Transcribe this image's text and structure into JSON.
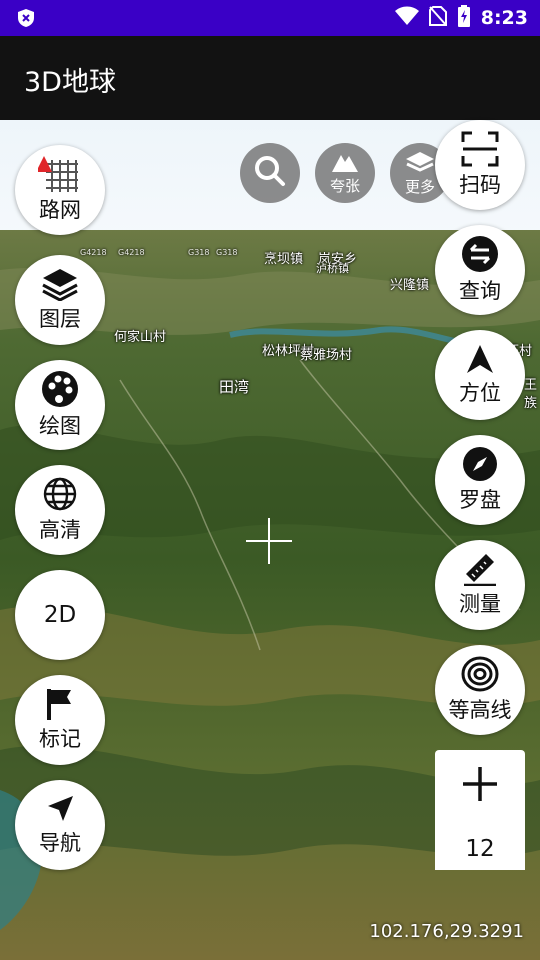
{
  "status_bar": {
    "time": "8:23",
    "icons": [
      "shield-icon",
      "wifi-icon",
      "no-sim-icon",
      "battery-charging-icon"
    ]
  },
  "app_bar": {
    "title": "3D地球"
  },
  "map": {
    "labels": [
      {
        "text": "烹坝镇"
      },
      {
        "text": "岚安乡"
      },
      {
        "text": "泸桥镇"
      },
      {
        "text": "兴隆镇"
      },
      {
        "text": "何家山村"
      },
      {
        "text": "松林坪村"
      },
      {
        "text": "蔡雅场村"
      },
      {
        "text": "旺村"
      },
      {
        "text": "田湾"
      },
      {
        "text": "王"
      },
      {
        "text": "族"
      },
      {
        "text": "G4218"
      },
      {
        "text": "G4218"
      },
      {
        "text": "G318"
      },
      {
        "text": "G318"
      }
    ],
    "coordinates": "102.176,29.3291"
  },
  "top_buttons": {
    "search": {
      "icon": "search-icon"
    },
    "exaggerate": {
      "label": "夸张",
      "icon": "mountain-icon"
    },
    "more": {
      "label": "更多",
      "icon": "layers-icon"
    }
  },
  "left_buttons": {
    "road_network": "路网",
    "layers": "图层",
    "draw": "绘图",
    "hd": "高清",
    "mode_2d": "2D",
    "mark": "标记",
    "navigate": "导航"
  },
  "right_buttons": {
    "scan": "扫码",
    "query": "查询",
    "orientation": "方位",
    "compass": "罗盘",
    "measure": "测量",
    "contour": "等高线"
  },
  "zoom": {
    "level": "12"
  }
}
